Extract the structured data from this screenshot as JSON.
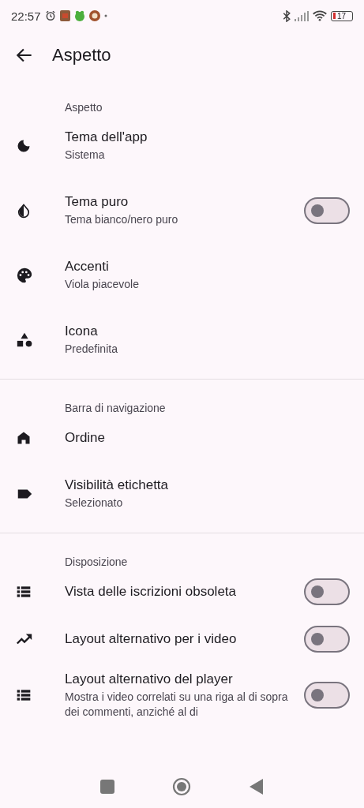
{
  "status_bar": {
    "time": "22:57",
    "battery": "17"
  },
  "top_bar": {
    "title": "Aspetto"
  },
  "sections": [
    {
      "header": "Aspetto",
      "items": [
        {
          "kind": "plain",
          "title": "Tema dell'app",
          "subtitle": "Sistema"
        },
        {
          "kind": "switch",
          "title": "Tema puro",
          "subtitle": "Tema bianco/nero puro",
          "on": false
        },
        {
          "kind": "plain",
          "title": "Accenti",
          "subtitle": "Viola piacevole"
        },
        {
          "kind": "plain",
          "title": "Icona",
          "subtitle": "Predefinita"
        }
      ]
    },
    {
      "header": "Barra di navigazione",
      "items": [
        {
          "kind": "plain",
          "title": "Ordine"
        },
        {
          "kind": "plain",
          "title": "Visibilità etichetta",
          "subtitle": "Selezionato"
        }
      ]
    },
    {
      "header": "Disposizione",
      "items": [
        {
          "kind": "switch",
          "title": "Vista delle iscrizioni obsoleta",
          "on": false
        },
        {
          "kind": "switch",
          "title": "Layout alternativo per i video",
          "on": false
        },
        {
          "kind": "switch",
          "title": "Layout alternativo del player",
          "subtitle": "Mostra i video correlati su una riga al di sopra dei commenti, anziché al di",
          "on": false
        }
      ]
    }
  ]
}
